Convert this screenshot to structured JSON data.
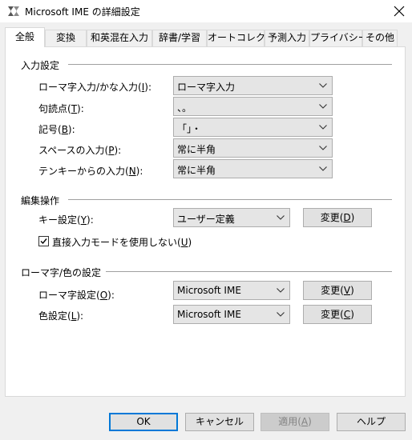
{
  "window": {
    "title": "Microsoft IME の詳細設定",
    "icon": "ime-settings-icon",
    "close_icon": "close-icon"
  },
  "tabs": [
    {
      "label": "全般",
      "active": true
    },
    {
      "label": "変換"
    },
    {
      "label": "和英混在入力"
    },
    {
      "label": "辞書/学習"
    },
    {
      "label": "オートコレクト"
    },
    {
      "label": "予測入力"
    },
    {
      "label": "プライバシー"
    },
    {
      "label": "その他"
    }
  ],
  "input_settings": {
    "title": "入力設定",
    "romaji_kana": {
      "label_pre": "ローマ字入力/かな入力(",
      "key": "I",
      "label_post": "):",
      "value": "ローマ字入力"
    },
    "punctuation": {
      "label_pre": "句読点(",
      "key": "T",
      "label_post": "):",
      "value": "、。"
    },
    "symbols": {
      "label_pre": "記号(",
      "key": "B",
      "label_post": "):",
      "value": "「」・"
    },
    "space": {
      "label_pre": "スペースの入力(",
      "key": "P",
      "label_post": "):",
      "value": "常に半角"
    },
    "tenkey": {
      "label_pre": "テンキーからの入力(",
      "key": "N",
      "label_post": "):",
      "value": "常に半角"
    }
  },
  "edit_ops": {
    "title": "編集操作",
    "key_settings": {
      "label_pre": "キー設定(",
      "key": "Y",
      "label_post": "):",
      "value": "ユーザー定義",
      "button_pre": "変更(",
      "button_key": "D",
      "button_post": ")"
    },
    "direct_input": {
      "checked": true,
      "label_pre": "直接入力モードを使用しない(",
      "key": "U",
      "label_post": ")"
    }
  },
  "romaji_color": {
    "title": "ローマ字/色の設定",
    "romaji": {
      "label_pre": "ローマ字設定(",
      "key": "O",
      "label_post": "):",
      "value": "Microsoft IME",
      "button_pre": "変更(",
      "button_key": "V",
      "button_post": ")"
    },
    "color": {
      "label_pre": "色設定(",
      "key": "L",
      "label_post": "):",
      "value": "Microsoft IME",
      "button_pre": "変更(",
      "button_key": "C",
      "button_post": ")"
    }
  },
  "footer": {
    "ok": "OK",
    "cancel": "キャンセル",
    "apply_pre": "適用(",
    "apply_key": "A",
    "apply_post": ")",
    "help": "ヘルプ"
  },
  "colors": {
    "accent": "#0078d7",
    "panel": "#ffffff",
    "background": "#f0f0f0"
  }
}
